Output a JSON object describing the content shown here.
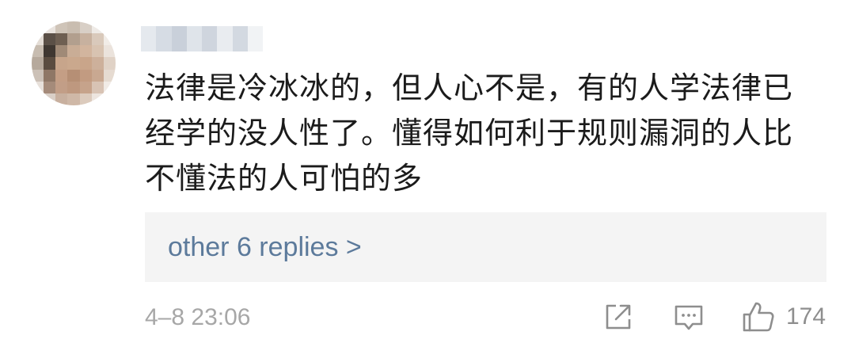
{
  "comment": {
    "text_lines": [
      "法律是冷冰冰的，但人心不是，有的人学法律已",
      "经学的没人性了。懂得如何利于规则漏洞的人比",
      "不懂法的人可怕的多"
    ],
    "replies_link": "other 6 replies >",
    "timestamp": "4–8 23:06",
    "like_count": "174"
  },
  "icons": {
    "share": "share-icon",
    "reply": "comment-icon",
    "like": "thumbs-up-icon"
  },
  "colors": {
    "text": "#1b1b1b",
    "link": "#5c7a9b",
    "meta": "#a7a7a7",
    "icon": "#8e8e8e",
    "reply_box_bg": "#f4f4f4"
  }
}
